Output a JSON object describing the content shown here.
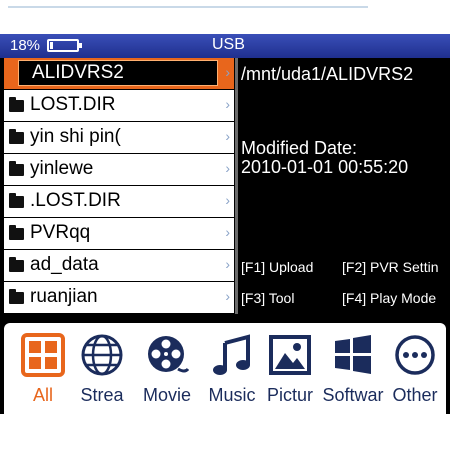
{
  "status": {
    "battery": "18%",
    "title": "USB"
  },
  "files": [
    {
      "name": "ALIDVRS2",
      "selected": true
    },
    {
      "name": "LOST.DIR"
    },
    {
      "name": "yin shi pin("
    },
    {
      "name": "yinlewe"
    },
    {
      "name": ".LOST.DIR"
    },
    {
      "name": "PVRqq"
    },
    {
      "name": "ad_data"
    },
    {
      "name": "ruanjian"
    }
  ],
  "info": {
    "path": "/mnt/uda1/ALIDVRS2",
    "modified_label": "Modified Date:",
    "modified_value": "2010-01-01 00:55:20"
  },
  "function_keys": {
    "f1": "[F1] Upload",
    "f2": "[F2] PVR Settin",
    "f3": "[F3] Tool",
    "f4": "[F4] Play Mode"
  },
  "categories": [
    {
      "label": "All",
      "icon": "grid-icon",
      "active": true
    },
    {
      "label": "Strea",
      "icon": "globe-icon"
    },
    {
      "label": "Movie",
      "icon": "film-reel-icon"
    },
    {
      "label": "Music",
      "icon": "music-note-icon"
    },
    {
      "label": "Pictur",
      "icon": "picture-icon"
    },
    {
      "label": "Softwar",
      "icon": "windows-icon"
    },
    {
      "label": "Other",
      "icon": "more-icon"
    }
  ],
  "colors": {
    "accent": "#e8661c",
    "statusbar": "#2a3da5",
    "label": "#1b2c5c"
  }
}
